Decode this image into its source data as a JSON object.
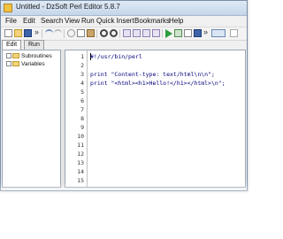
{
  "window": {
    "title": "Untitled - DzSoft Perl Editor 5.8.7"
  },
  "menu": [
    "File",
    "Edit",
    "Search",
    "View",
    "Run",
    "Quick Insert",
    "Bookmarks",
    "Help"
  ],
  "toolbar": {
    "overflow": "»",
    "overflow2": "»"
  },
  "tabs": [
    "Edit",
    "Run"
  ],
  "tree": [
    "Subroutines",
    "Variables"
  ],
  "editor": {
    "line_numbers": [
      "1",
      "2",
      "3",
      "4",
      "5",
      "6",
      "7",
      "8",
      "9",
      "10",
      "11",
      "12",
      "13",
      "14",
      "15"
    ],
    "lines": [
      "#!/usr/bin/perl",
      "",
      "print \"Content-type: text/html\\n\\n\";",
      "print \"<html><h1>Hello!</h1></html>\\n\";"
    ]
  }
}
